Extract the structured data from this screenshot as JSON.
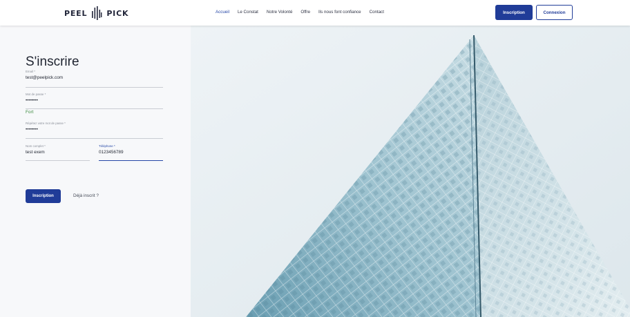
{
  "header": {
    "logo_left": "PEEL",
    "logo_right": "PICK",
    "nav": [
      "Accueil",
      "Le Constat",
      "Notre Volonté",
      "Offre",
      "Ils nous font confiance",
      "Contact"
    ],
    "active_nav": "Accueil",
    "signup_label": "Inscription",
    "login_label": "Connexion"
  },
  "form": {
    "title": "S'inscrire",
    "email": {
      "label": "Email *",
      "value": "test@peelpick.com"
    },
    "password": {
      "label": "Mot de passe *",
      "value": "••••••••"
    },
    "strength": "Fort",
    "password_confirm": {
      "label": "Répétez votre mot de passe *",
      "value": "••••••••"
    },
    "full_name": {
      "label": "Nom complet *",
      "value": "test exem"
    },
    "phone": {
      "label": "Téléphone *",
      "value": "0123456789"
    },
    "submit_label": "Inscription",
    "login_link": "Déjà inscrit ?"
  },
  "colors": {
    "primary": "#203c98",
    "accent": "#2446a6",
    "strength_ok": "#3b8a3e",
    "panel_bg": "#f7f8fa"
  }
}
